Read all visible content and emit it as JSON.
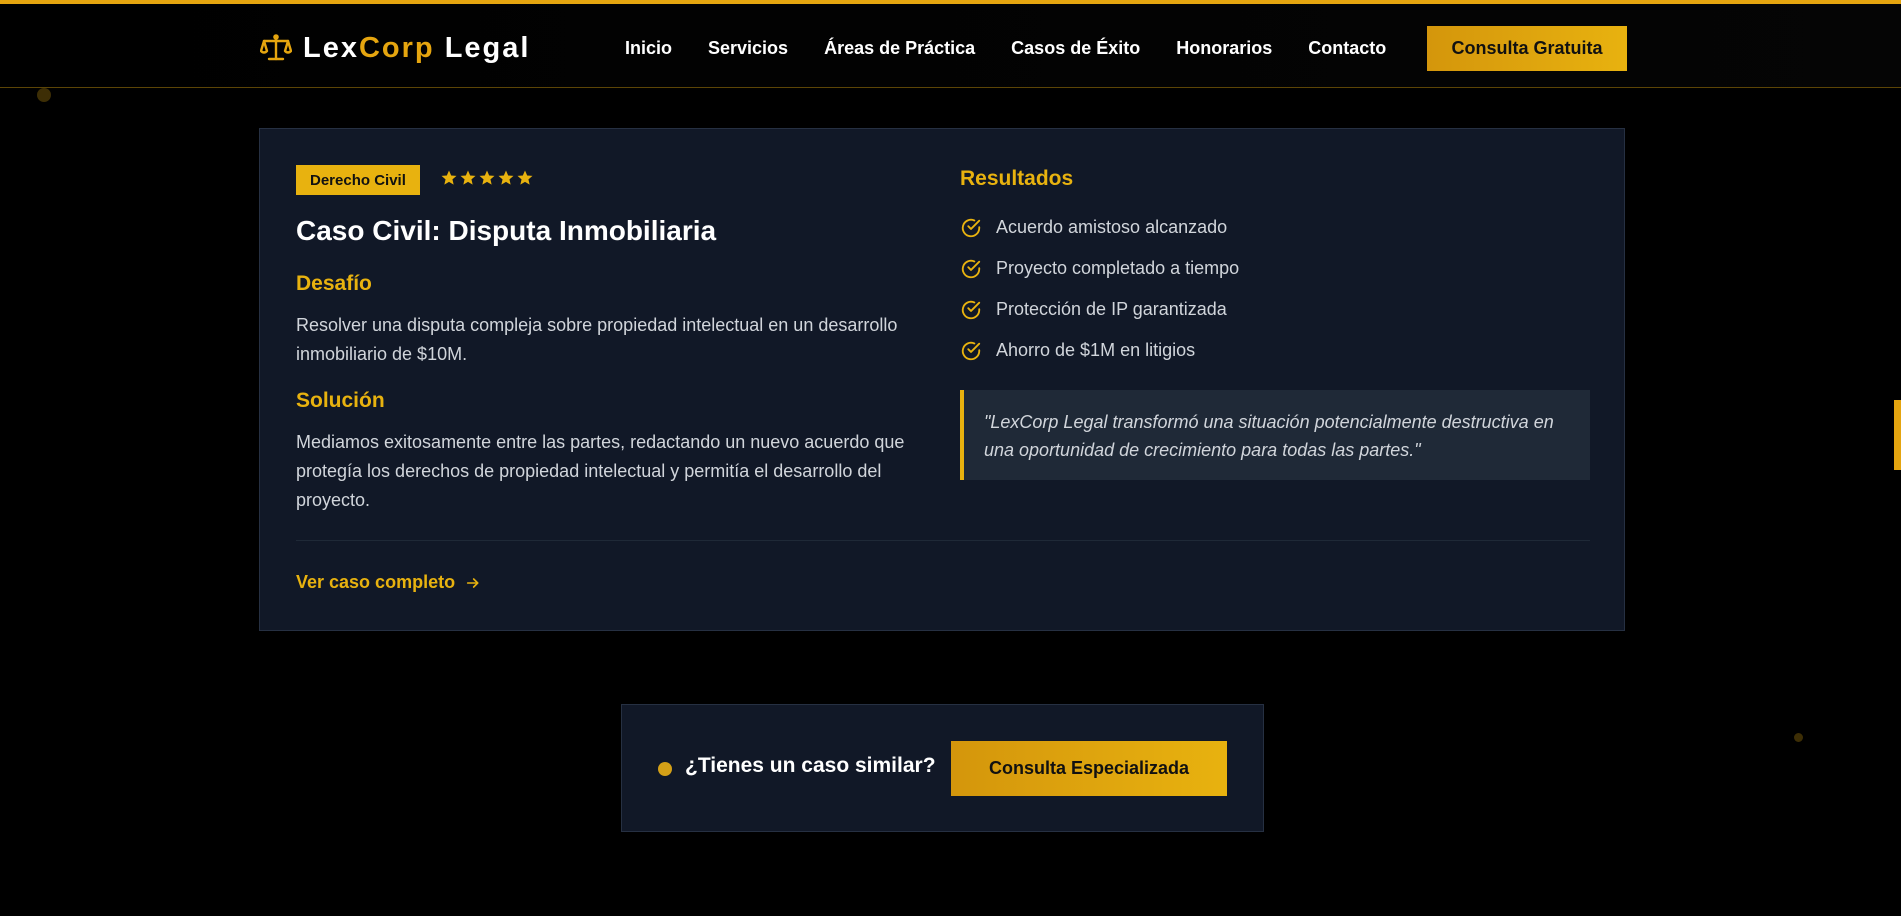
{
  "brand": {
    "name_part1": "Lex",
    "name_part2": "Corp",
    "name_part3": " Legal",
    "accent_color": "#e8b20f",
    "icon": "scales-icon"
  },
  "nav": {
    "items": [
      {
        "label": "Inicio"
      },
      {
        "label": "Servicios"
      },
      {
        "label": "Áreas de Práctica"
      },
      {
        "label": "Casos de Éxito"
      },
      {
        "label": "Honorarios"
      },
      {
        "label": "Contacto"
      }
    ],
    "cta_label": "Consulta Gratuita"
  },
  "case": {
    "category": "Derecho Civil",
    "rating": 5,
    "title": "Caso Civil: Disputa Inmobiliaria",
    "challenge_heading": "Desafío",
    "challenge_text": "Resolver una disputa compleja sobre propiedad intelectual en un desarrollo inmobiliario de $10M.",
    "solution_heading": "Solución",
    "solution_text": "Mediamos exitosamente entre las partes, redactando un nuevo acuerdo que protegía los derechos de propiedad intelectual y permitía el desarrollo del proyecto.",
    "results_heading": "Resultados",
    "results": [
      "Acuerdo amistoso alcanzado",
      "Proyecto completado a tiempo",
      "Protección de IP garantizada",
      "Ahorro de $1M en litigios"
    ],
    "quote": "\"LexCorp Legal transformó una situación potencialmente destructiva en una oportunidad de crecimiento para todas las partes.\"",
    "link_label": "Ver caso completo"
  },
  "cta": {
    "question": "¿Tienes un caso similar?",
    "button_label": "Consulta Especializada"
  }
}
